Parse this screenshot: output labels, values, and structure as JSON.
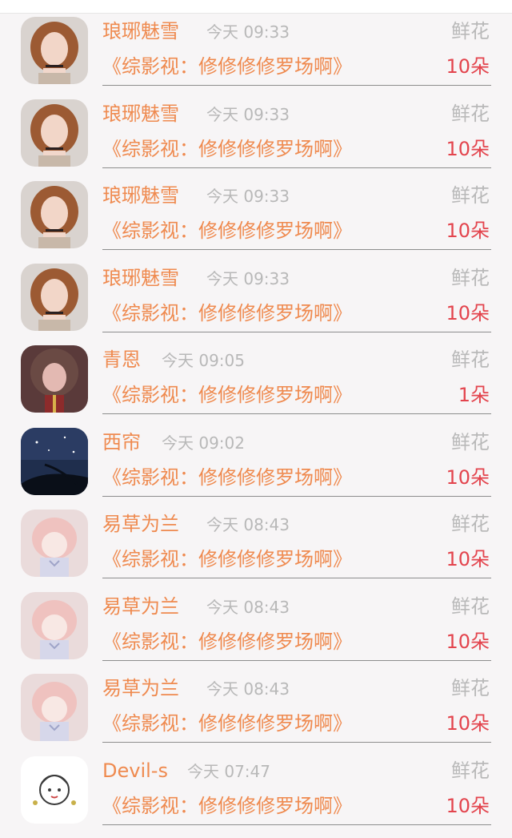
{
  "items": [
    {
      "name": "琅琊魅雪",
      "time": "今天 09:33",
      "gift": "鲜花",
      "title": "《综影视：修修修修罗场啊》",
      "count": "10朵",
      "avatar": "woman-portrait-avatar"
    },
    {
      "name": "琅琊魅雪",
      "time": "今天 09:33",
      "gift": "鲜花",
      "title": "《综影视：修修修修罗场啊》",
      "count": "10朵",
      "avatar": "woman-portrait-avatar"
    },
    {
      "name": "琅琊魅雪",
      "time": "今天 09:33",
      "gift": "鲜花",
      "title": "《综影视：修修修修罗场啊》",
      "count": "10朵",
      "avatar": "woman-portrait-avatar"
    },
    {
      "name": "琅琊魅雪",
      "time": "今天 09:33",
      "gift": "鲜花",
      "title": "《综影视：修修修修罗场啊》",
      "count": "10朵",
      "avatar": "woman-portrait-avatar"
    },
    {
      "name": "青恩",
      "time": "今天 09:05",
      "gift": "鲜花",
      "title": "《综影视：修修修修罗场啊》",
      "count": "1朵",
      "avatar": "girl-portrait-avatar"
    },
    {
      "name": "西帘",
      "time": "今天 09:02",
      "gift": "鲜花",
      "title": "《综影视：修修修修罗场啊》",
      "count": "10朵",
      "avatar": "night-sky-avatar"
    },
    {
      "name": "易草为兰",
      "time": "今天 08:43",
      "gift": "鲜花",
      "title": "《综影视：修修修修罗场啊》",
      "count": "10朵",
      "avatar": "anime-girl-avatar"
    },
    {
      "name": "易草为兰",
      "time": "今天 08:43",
      "gift": "鲜花",
      "title": "《综影视：修修修修罗场啊》",
      "count": "10朵",
      "avatar": "anime-girl-avatar"
    },
    {
      "name": "易草为兰",
      "time": "今天 08:43",
      "gift": "鲜花",
      "title": "《综影视：修修修修罗场啊》",
      "count": "10朵",
      "avatar": "anime-girl-avatar"
    },
    {
      "name": "Devil-s",
      "time": "今天 07:47",
      "gift": "鲜花",
      "title": "《综影视：修修修修罗场啊》",
      "count": "10朵",
      "avatar": "cartoon-sketch-avatar"
    }
  ],
  "colors": {
    "name": "#ef8a4f",
    "time": "#b8b8b8",
    "gift": "#b9b9b9",
    "count": "#e3444d",
    "background": "#f7f5f6"
  }
}
